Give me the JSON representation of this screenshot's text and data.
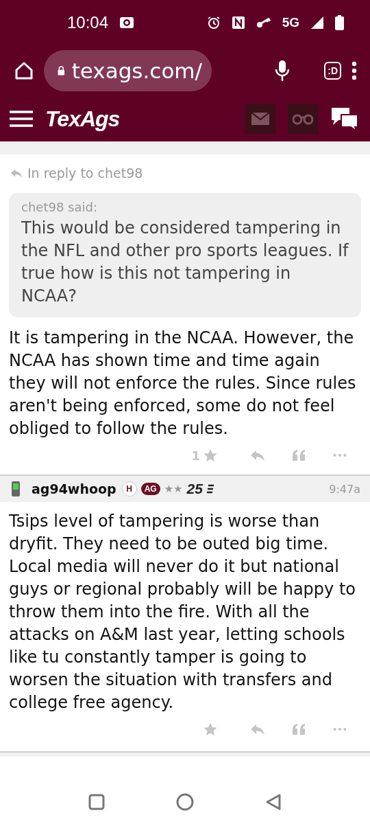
{
  "status_bar": {
    "time": "10:04",
    "network": "5G"
  },
  "browser": {
    "url": "texags.com/",
    "tab_icon": ":D"
  },
  "site_header": {
    "logo": "TexAgs"
  },
  "reply_post": {
    "reply_to": "In reply to chet98",
    "quote_author": "chet98 said:",
    "quote_text": "This would be considered tampering in the NFL and other pro sports leagues. If true how is this not tampering in NCAA?",
    "body": "It is tampering in the NCAA. However, the NCAA has shown time and time again they will not enforce the rules. Since rules aren't being enforced, some do not feel obliged to follow the rules.",
    "likes": "1"
  },
  "post": {
    "author": "ag94whoop",
    "badges": [
      {
        "kind": "circle",
        "text": "H"
      },
      {
        "kind": "pill",
        "text": "AG"
      }
    ],
    "stars": "★★",
    "rank": "25",
    "time": "9:47a",
    "body": "Tsips level of tampering is worse than dryfit. They need to be outed big time. Local media will never do it but national guys or regional probably will be happy to throw them into the fire. With all the attacks on A&M last year, letting schools like tu constantly tamper is going to worsen the situation with transfers and college free agency."
  }
}
